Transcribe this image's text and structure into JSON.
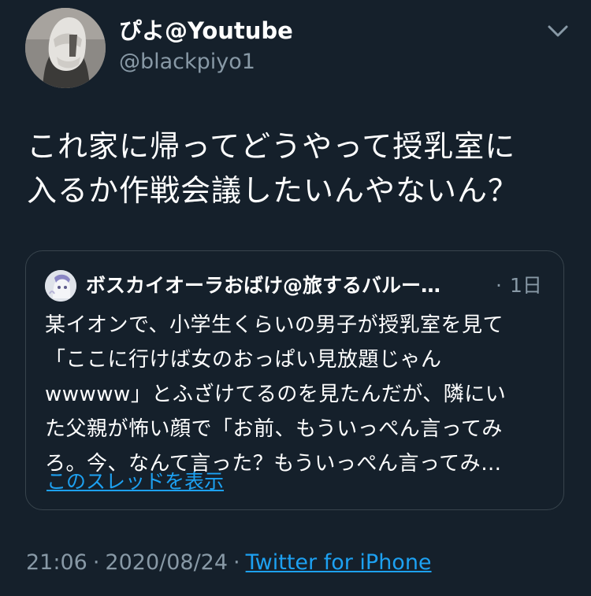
{
  "author": {
    "display_name": "ぴよ@Youtube",
    "handle": "@blackpiyo1",
    "avatar_icon": "masked-person-avatar"
  },
  "menu": {
    "icon": "chevron-down-icon"
  },
  "tweet": {
    "text_lines": [
      "これ家に帰ってどうやって授乳室に",
      "入るか作戦会議したいんやないん？"
    ]
  },
  "quoted_tweet": {
    "author_name": "ボスカイオーラおばけ@旅するバルー…",
    "separator": "·",
    "time_ago": "1日",
    "text_lines": [
      "某イオンで、小学生くらいの男子が授乳室を見て",
      "「ここに行けば女のおっぱい見放題じゃん",
      "wwwww」とふざけてるのを見たんだが、隣にい",
      "た父親が怖い顔で「お前、もういっぺん言ってみ",
      "ろ。今、なんて言った？もういっぺん言ってみ…"
    ],
    "show_thread_label": "このスレッドを表示"
  },
  "meta": {
    "time": "21:06",
    "separator": "·",
    "date": "2020/08/24",
    "source": "Twitter for iPhone"
  },
  "colors": {
    "background": "#15202b",
    "text": "#ffffff",
    "secondary_text": "#8899a6",
    "link": "#1da1f2",
    "border": "#38444d"
  }
}
